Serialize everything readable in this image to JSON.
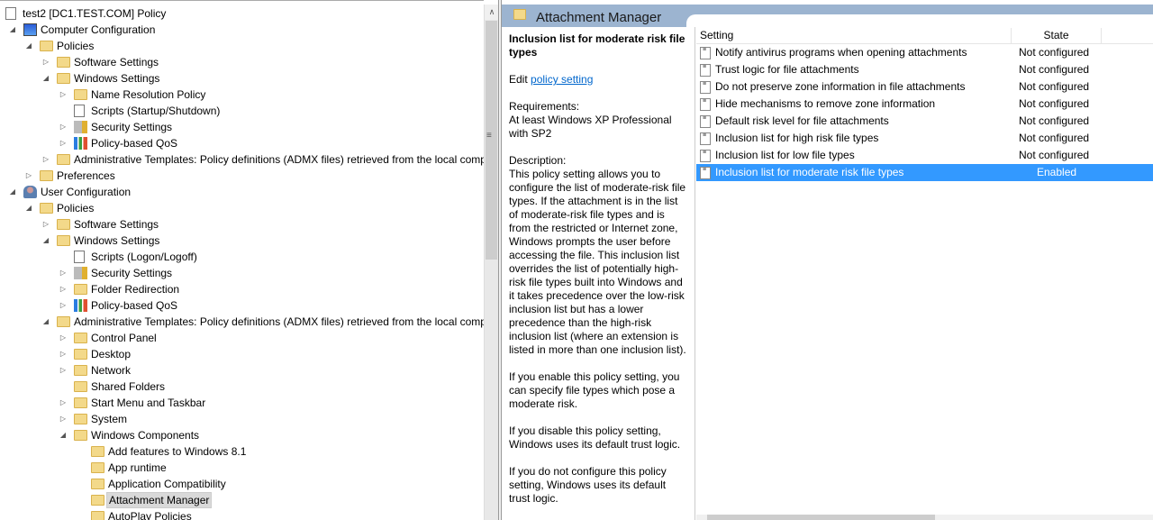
{
  "tree": [
    {
      "level": 0,
      "expander": "none",
      "icon": "policy-doc",
      "label": "test2 [DC1.TEST.COM] Policy"
    },
    {
      "level": 1,
      "expander": "open",
      "icon": "computer",
      "label": "Computer Configuration"
    },
    {
      "level": 2,
      "expander": "open",
      "icon": "folder",
      "label": "Policies"
    },
    {
      "level": 3,
      "expander": "closed",
      "icon": "folder",
      "label": "Software Settings"
    },
    {
      "level": 3,
      "expander": "open",
      "icon": "folder",
      "label": "Windows Settings"
    },
    {
      "level": 4,
      "expander": "closed",
      "icon": "folder",
      "label": "Name Resolution Policy"
    },
    {
      "level": 4,
      "expander": "none",
      "icon": "script",
      "label": "Scripts (Startup/Shutdown)"
    },
    {
      "level": 4,
      "expander": "closed",
      "icon": "security",
      "label": "Security Settings"
    },
    {
      "level": 4,
      "expander": "closed",
      "icon": "qos",
      "label": "Policy-based QoS"
    },
    {
      "level": 3,
      "expander": "closed",
      "icon": "folder",
      "label": "Administrative Templates: Policy definitions (ADMX files) retrieved from the local computer"
    },
    {
      "level": 2,
      "expander": "closed",
      "icon": "folder",
      "label": "Preferences"
    },
    {
      "level": 1,
      "expander": "open",
      "icon": "user",
      "label": "User Configuration"
    },
    {
      "level": 2,
      "expander": "open",
      "icon": "folder",
      "label": "Policies"
    },
    {
      "level": 3,
      "expander": "closed",
      "icon": "folder",
      "label": "Software Settings"
    },
    {
      "level": 3,
      "expander": "open",
      "icon": "folder",
      "label": "Windows Settings"
    },
    {
      "level": 4,
      "expander": "none",
      "icon": "script",
      "label": "Scripts (Logon/Logoff)"
    },
    {
      "level": 4,
      "expander": "closed",
      "icon": "security",
      "label": "Security Settings"
    },
    {
      "level": 4,
      "expander": "closed",
      "icon": "folder",
      "label": "Folder Redirection"
    },
    {
      "level": 4,
      "expander": "closed",
      "icon": "qos",
      "label": "Policy-based QoS"
    },
    {
      "level": 3,
      "expander": "open",
      "icon": "folder",
      "label": "Administrative Templates: Policy definitions (ADMX files) retrieved from the local computer"
    },
    {
      "level": 4,
      "expander": "closed",
      "icon": "folder",
      "label": "Control Panel"
    },
    {
      "level": 4,
      "expander": "closed",
      "icon": "folder",
      "label": "Desktop"
    },
    {
      "level": 4,
      "expander": "closed",
      "icon": "folder",
      "label": "Network"
    },
    {
      "level": 4,
      "expander": "none",
      "icon": "folder",
      "label": "Shared Folders"
    },
    {
      "level": 4,
      "expander": "closed",
      "icon": "folder",
      "label": "Start Menu and Taskbar"
    },
    {
      "level": 4,
      "expander": "closed",
      "icon": "folder",
      "label": "System"
    },
    {
      "level": 4,
      "expander": "open",
      "icon": "folder",
      "label": "Windows Components"
    },
    {
      "level": 5,
      "expander": "none",
      "icon": "folder",
      "label": "Add features to Windows 8.1"
    },
    {
      "level": 5,
      "expander": "none",
      "icon": "folder",
      "label": "App runtime"
    },
    {
      "level": 5,
      "expander": "none",
      "icon": "folder",
      "label": "Application Compatibility"
    },
    {
      "level": 5,
      "expander": "none",
      "icon": "folder",
      "label": "Attachment Manager",
      "selected": true
    },
    {
      "level": 5,
      "expander": "none",
      "icon": "folder",
      "label": "AutoPlay Policies"
    }
  ],
  "header": {
    "title": "Attachment Manager",
    "color": "#9cb4d0"
  },
  "description": {
    "title": "Inclusion list for moderate risk file types",
    "edit_prefix": "Edit ",
    "edit_link": "policy setting ",
    "requirements_label": "Requirements:",
    "requirements": "At least Windows XP Professional with SP2",
    "description_label": "Description:",
    "paragraphs": [
      "This policy setting allows you to configure the list of moderate-risk file types. If the attachment is in the list of moderate-risk file types and is from the restricted or Internet zone, Windows prompts the user before accessing the file. This inclusion list overrides the list of potentially high-risk file types built into Windows and it takes precedence over the low-risk inclusion list but has a lower precedence than the high-risk inclusion list (where an extension is listed in more than one inclusion list).",
      "If you enable this policy setting, you can specify file types which pose a moderate risk.",
      "If you disable this policy setting, Windows uses its default trust logic.",
      "If you do not configure this policy setting, Windows uses its default trust logic."
    ]
  },
  "list": {
    "columns": [
      "Setting",
      "State",
      ""
    ],
    "rows": [
      {
        "setting": "Notify antivirus programs when opening attachments",
        "state": "Not configured"
      },
      {
        "setting": "Trust logic for file attachments",
        "state": "Not configured"
      },
      {
        "setting": "Do not preserve zone information in file attachments",
        "state": "Not configured"
      },
      {
        "setting": "Hide mechanisms to remove zone information",
        "state": "Not configured"
      },
      {
        "setting": "Default risk level for file attachments",
        "state": "Not configured"
      },
      {
        "setting": "Inclusion list for high risk file types",
        "state": "Not configured"
      },
      {
        "setting": "Inclusion list for low file types",
        "state": "Not configured"
      },
      {
        "setting": "Inclusion list for moderate risk file types",
        "state": "Enabled",
        "selected": true
      }
    ],
    "selection_color": "#3399ff"
  }
}
